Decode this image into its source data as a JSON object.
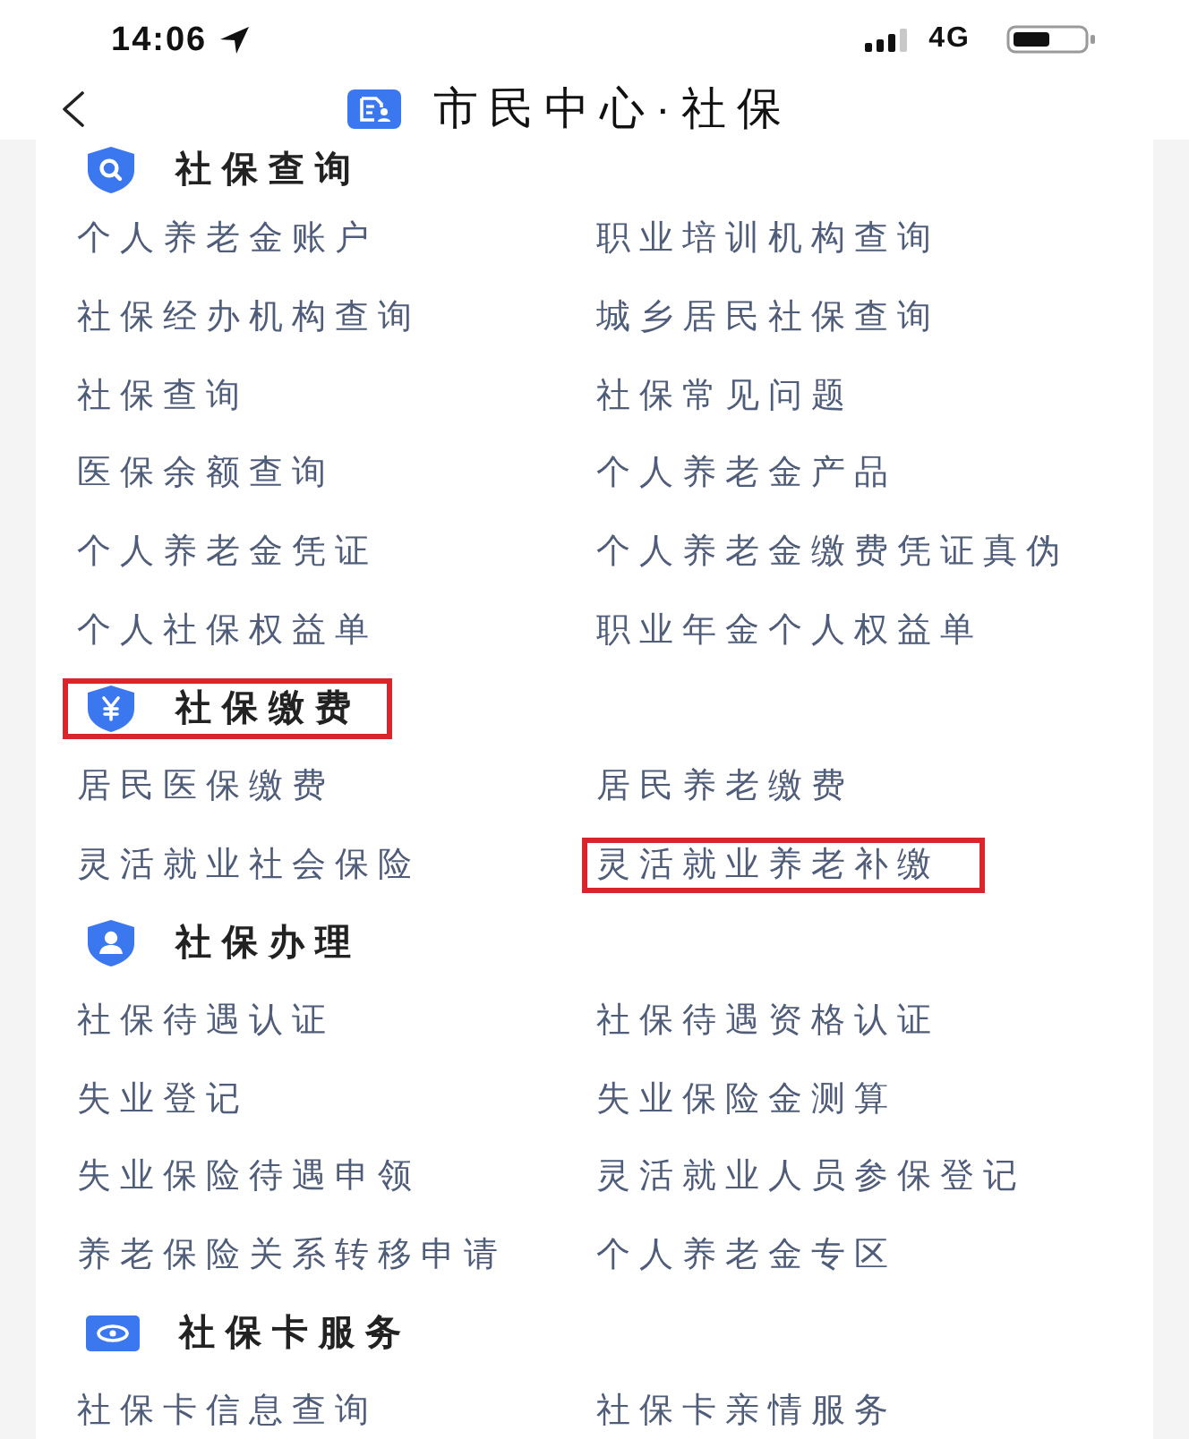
{
  "status_bar": {
    "time": "14:06",
    "network": "4G"
  },
  "nav_bar": {
    "title": "市民中心·社保"
  },
  "sections": [
    {
      "kind": "query",
      "title": "社保查询",
      "highlighted": false,
      "items": [
        {
          "label": "个人养老金账户",
          "highlighted": false
        },
        {
          "label": "职业培训机构查询",
          "highlighted": false
        },
        {
          "label": "社保经办机构查询",
          "highlighted": false
        },
        {
          "label": "城乡居民社保查询",
          "highlighted": false
        },
        {
          "label": "社保查询",
          "highlighted": false
        },
        {
          "label": "社保常见问题",
          "highlighted": false
        },
        {
          "label": "医保余额查询",
          "highlighted": false
        },
        {
          "label": "个人养老金产品",
          "highlighted": false
        },
        {
          "label": "个人养老金凭证",
          "highlighted": false
        },
        {
          "label": "个人养老金缴费凭证真伪",
          "highlighted": false
        },
        {
          "label": "个人社保权益单",
          "highlighted": false
        },
        {
          "label": "职业年金个人权益单",
          "highlighted": false
        }
      ]
    },
    {
      "kind": "payment",
      "title": "社保缴费",
      "highlighted": true,
      "items": [
        {
          "label": "居民医保缴费",
          "highlighted": false
        },
        {
          "label": "居民养老缴费",
          "highlighted": false
        },
        {
          "label": "灵活就业社会保险",
          "highlighted": false
        },
        {
          "label": "灵活就业养老补缴",
          "highlighted": true
        }
      ]
    },
    {
      "kind": "handling",
      "title": "社保办理",
      "highlighted": false,
      "items": [
        {
          "label": "社保待遇认证",
          "highlighted": false
        },
        {
          "label": "社保待遇资格认证",
          "highlighted": false
        },
        {
          "label": "失业登记",
          "highlighted": false
        },
        {
          "label": "失业保险金测算",
          "highlighted": false
        },
        {
          "label": "失业保险待遇申领",
          "highlighted": false
        },
        {
          "label": "灵活就业人员参保登记",
          "highlighted": false
        },
        {
          "label": "养老保险关系转移申请",
          "highlighted": false
        },
        {
          "label": "个人养老金专区",
          "highlighted": false
        }
      ]
    },
    {
      "kind": "card",
      "title": "社保卡服务",
      "highlighted": false,
      "items": [
        {
          "label": "社保卡信息查询",
          "highlighted": false
        },
        {
          "label": "社保卡亲情服务",
          "highlighted": false
        }
      ]
    }
  ]
}
